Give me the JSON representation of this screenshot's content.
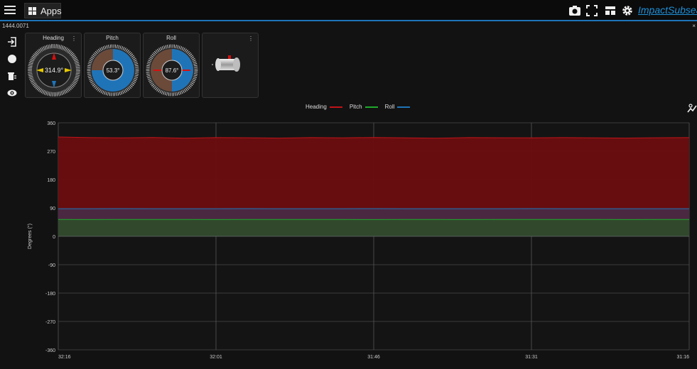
{
  "header": {
    "apps_label": "Apps",
    "brand": "ImpactSubsea",
    "icons": [
      "camera-icon",
      "fullscreen-icon",
      "layout-icon",
      "gear-icon"
    ]
  },
  "device": {
    "serial": "1444.0071",
    "close": "×"
  },
  "sidebar": {
    "icons": [
      "login-icon",
      "record-icon",
      "delete-icon",
      "eye-icon"
    ]
  },
  "widgets": {
    "heading": {
      "title": "Heading",
      "value": "314.9°",
      "dots": "⋮"
    },
    "pitch": {
      "title": "Pitch",
      "value": "53.3°"
    },
    "roll": {
      "title": "Roll",
      "value": "87.6°"
    },
    "model": {
      "dots": "⋮"
    }
  },
  "legend": {
    "items": [
      {
        "name": "Heading",
        "color": "#c0141a"
      },
      {
        "name": "Pitch",
        "color": "#1faa2c"
      },
      {
        "name": "Roll",
        "color": "#1f74b8"
      }
    ]
  },
  "chart_data": {
    "type": "area",
    "ylabel": "Degrees (°)",
    "ylim": [
      -360,
      360
    ],
    "yticks": [
      360,
      270,
      180,
      90,
      0,
      -90,
      -180,
      -270,
      -360
    ],
    "xticks": [
      "32:16",
      "32:01",
      "31:46",
      "31:31",
      "31:16"
    ],
    "grid": true,
    "series": [
      {
        "name": "Heading",
        "color": "#c0141a",
        "values": [
          314.9,
          313,
          312,
          313.5,
          311,
          313,
          312.5,
          311.5,
          313,
          312,
          313.5,
          312,
          311,
          313,
          312.5,
          312,
          313,
          312,
          311.5,
          312.5,
          313
        ]
      },
      {
        "name": "Roll",
        "color": "#1f74b8",
        "values": [
          87.6,
          87.5,
          87.7,
          87.6,
          87.5,
          87.6,
          87.7,
          87.6,
          87.5,
          87.6,
          87.7,
          87.6,
          87.5,
          87.6,
          87.6,
          87.7,
          87.6,
          87.5,
          87.6,
          87.6,
          87.6
        ]
      },
      {
        "name": "Pitch",
        "color": "#1faa2c",
        "values": [
          53.3,
          53.2,
          53.3,
          53.4,
          53.3,
          53.2,
          53.3,
          53.3,
          53.4,
          53.3,
          53.2,
          53.3,
          53.3,
          53.2,
          53.3,
          53.4,
          53.3,
          53.3,
          53.2,
          53.3,
          53.3
        ]
      }
    ]
  }
}
